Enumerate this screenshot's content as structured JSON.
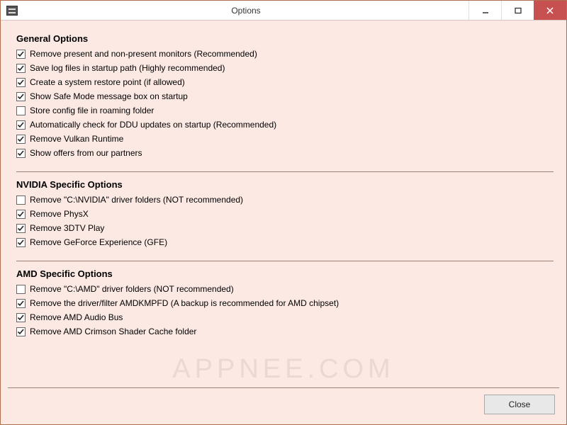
{
  "window": {
    "title": "Options",
    "close_label": "Close"
  },
  "watermark": "APPNEE.COM",
  "sections": {
    "general": {
      "heading": "General Options",
      "items": [
        {
          "checked": true,
          "label": "Remove present and non-present monitors (Recommended)"
        },
        {
          "checked": true,
          "label": "Save log files in startup path (Highly recommended)"
        },
        {
          "checked": true,
          "label": "Create a system restore point (if allowed)"
        },
        {
          "checked": true,
          "label": "Show Safe Mode message box on startup"
        },
        {
          "checked": false,
          "label": "Store config file in roaming folder"
        },
        {
          "checked": true,
          "label": "Automatically check for DDU updates on startup (Recommended)"
        },
        {
          "checked": true,
          "label": "Remove Vulkan Runtime"
        },
        {
          "checked": true,
          "label": "Show offers from our partners"
        }
      ]
    },
    "nvidia": {
      "heading": "NVIDIA Specific Options",
      "items": [
        {
          "checked": false,
          "label": "Remove \"C:\\NVIDIA\" driver folders (NOT recommended)"
        },
        {
          "checked": true,
          "label": "Remove PhysX"
        },
        {
          "checked": true,
          "label": "Remove 3DTV Play"
        },
        {
          "checked": true,
          "label": "Remove GeForce Experience (GFE)"
        }
      ]
    },
    "amd": {
      "heading": "AMD Specific Options",
      "items": [
        {
          "checked": false,
          "label": "Remove \"C:\\AMD\" driver folders (NOT recommended)"
        },
        {
          "checked": true,
          "label": "Remove the driver/filter AMDKMPFD (A backup is recommended for AMD chipset)"
        },
        {
          "checked": true,
          "label": "Remove AMD Audio Bus"
        },
        {
          "checked": true,
          "label": "Remove AMD Crimson Shader Cache folder"
        }
      ]
    }
  }
}
